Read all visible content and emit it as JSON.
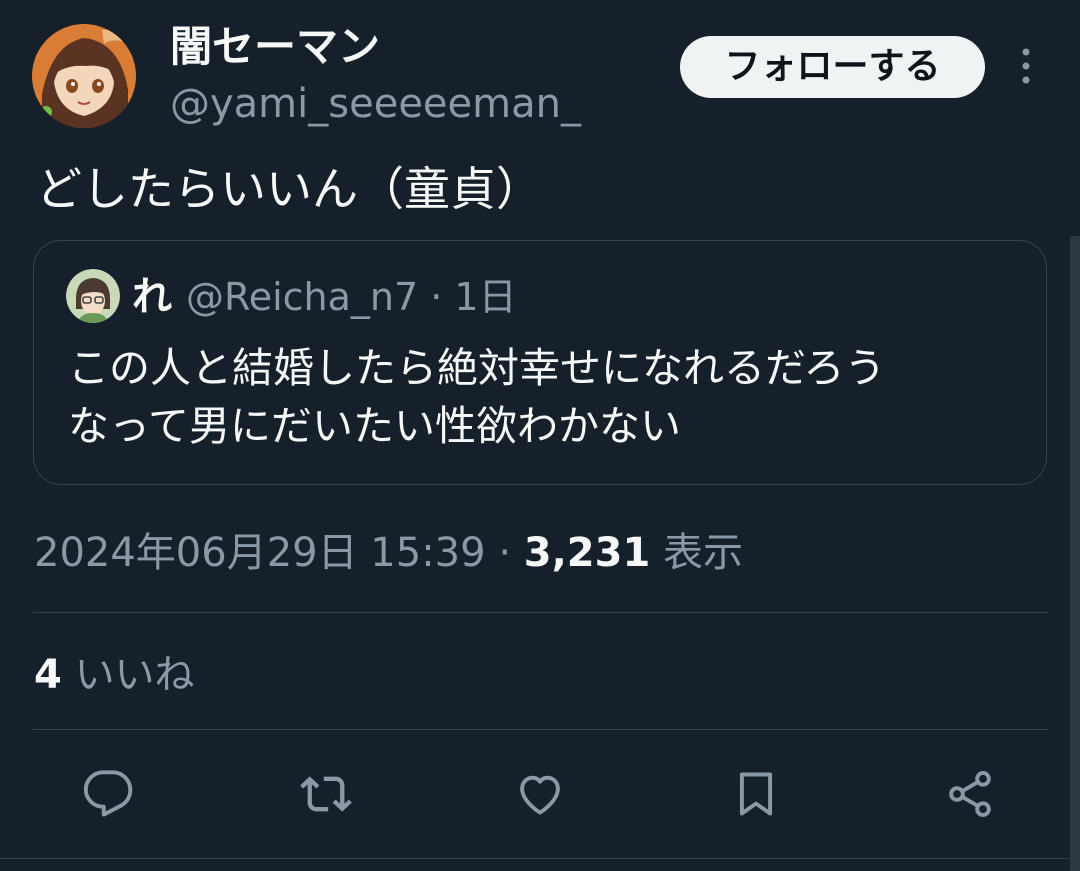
{
  "author": {
    "display_name": "闇セーマン",
    "handle": "@yami_seeeeeman_",
    "avatar_icon": "anime-girl-avatar-icon"
  },
  "header": {
    "follow_label": "フォローする",
    "more_icon": "more-vertical-icon"
  },
  "tweet": {
    "text": "どしたらいいん（童貞）"
  },
  "quote": {
    "name": "れ",
    "handle_time": "@Reicha_n7 · 1日",
    "avatar_icon": "glasses-avatar-icon",
    "lines": [
      "この人と結婚したら絶対幸せになれるだろう",
      "なって男にだいたい性欲わかない"
    ]
  },
  "meta": {
    "datetime": "2024年06月29日 15:39",
    "separator": "·",
    "views_count": "3,231",
    "views_label": "表示"
  },
  "likes": {
    "count": "4",
    "label": "いいね"
  },
  "actions": [
    {
      "name": "reply-icon"
    },
    {
      "name": "retweet-icon"
    },
    {
      "name": "like-icon"
    },
    {
      "name": "bookmark-icon"
    },
    {
      "name": "share-icon"
    }
  ],
  "colors": {
    "background": "#15202b",
    "text_primary": "#f7f9f9",
    "text_secondary": "#8b98a5",
    "border": "#38444d",
    "follow_bg": "#eff3f4"
  }
}
